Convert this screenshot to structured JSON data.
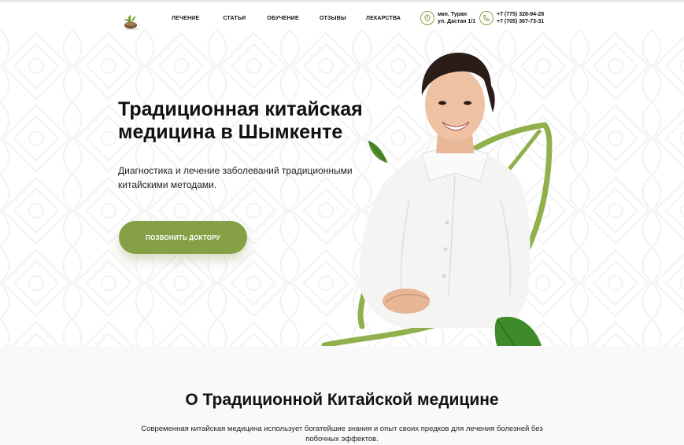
{
  "header": {
    "nav": [
      "ЛЕЧЕНИЕ",
      "СТАТЬИ",
      "ОБУЧЕНИЕ",
      "ОТЗЫВЫ",
      "ЛЕКАРСТВА"
    ],
    "address": {
      "line1": "мкн. Туран",
      "line2": "ул. Дастан 1/1"
    },
    "phones": {
      "phone1": "+7 (775) 328-94-28",
      "phone2": "+7 (705) 367-73-31"
    }
  },
  "hero": {
    "title_line1": "Традиционная китайская",
    "title_line2": "медицина в Шымкенте",
    "subtitle_line1": "Диагностика и лечение заболеваний традиционными",
    "subtitle_line2": "китайскими методами.",
    "cta_label": "ПОЗВОНИТЬ ДОКТОРУ"
  },
  "about": {
    "title": "О Традиционной Китайской медицине",
    "text_line1": "Современная китайская медицина использует богатейшие знания и опыт своих предков для лечения болезней без",
    "text_line2": "побочных эффектов."
  },
  "colors": {
    "accent": "#86a046",
    "leaf_dark": "#4f8a2c",
    "text": "#111111"
  },
  "icons": [
    "logo-icon",
    "location-pin-icon",
    "phone-icon",
    "leaf-icon"
  ]
}
